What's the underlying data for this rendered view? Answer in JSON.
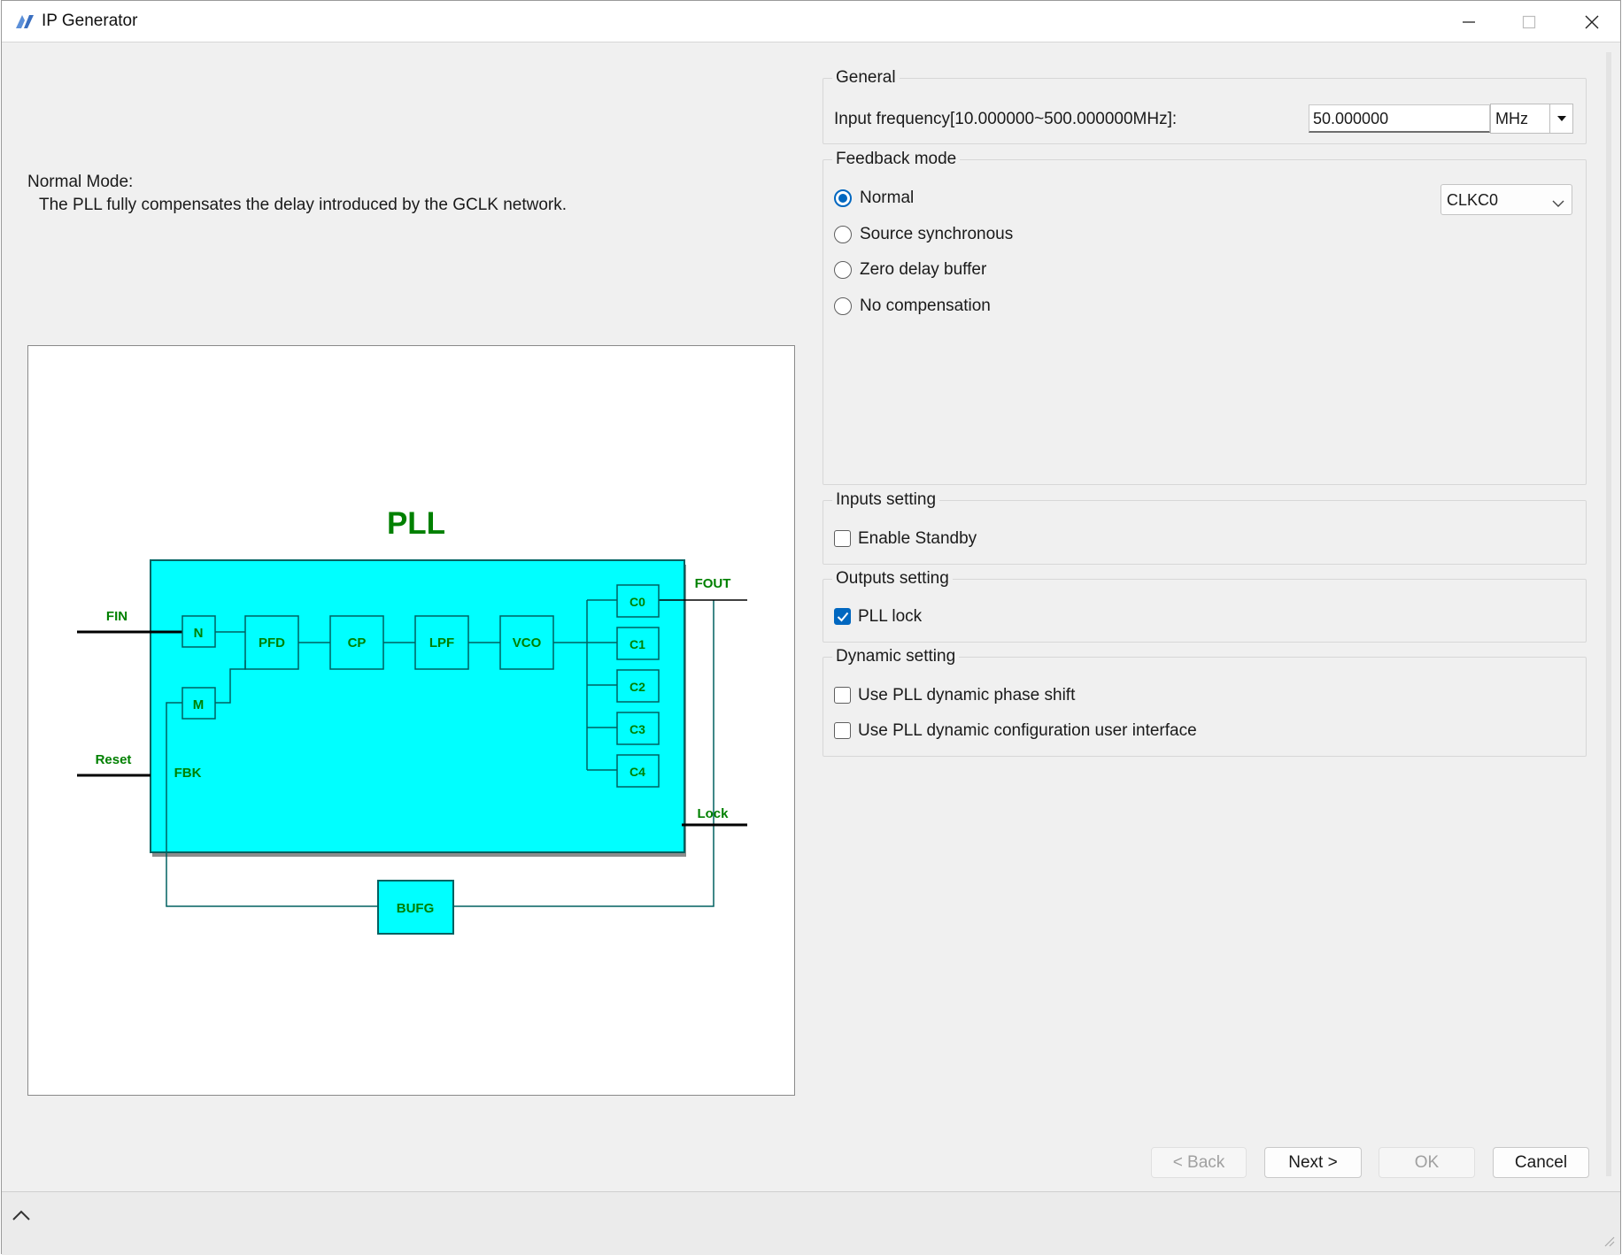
{
  "window": {
    "title": "IP Generator",
    "icons": [
      "app-logo-icon",
      "minimize-icon",
      "maximize-icon",
      "close-icon"
    ]
  },
  "mode": {
    "title": "Normal Mode:",
    "description": "The PLL fully compensates the delay introduced by the GCLK network."
  },
  "diagram": {
    "title": "PLL",
    "inputs": {
      "fin": "FIN",
      "reset": "Reset",
      "fbk": "FBK"
    },
    "outputs": {
      "fout": "FOUT",
      "lock": "Lock"
    },
    "blocks": {
      "n": "N",
      "m": "M",
      "pfd": "PFD",
      "cp": "CP",
      "lpf": "LPF",
      "vco": "VCO",
      "bufg": "BUFG"
    },
    "counters": [
      "C0",
      "C1",
      "C2",
      "C3",
      "C4"
    ],
    "colors": {
      "block_fill": "#00ffff",
      "label": "#008000"
    }
  },
  "general": {
    "legend": "General",
    "input_frequency_label": "Input frequency[10.000000~500.000000MHz]:",
    "input_frequency_value": "50.000000",
    "unit": "MHz"
  },
  "feedback": {
    "legend": "Feedback mode",
    "options": [
      "Normal",
      "Source synchronous",
      "Zero delay buffer",
      "No compensation"
    ],
    "selected": "Normal",
    "clock_select": "CLKC0"
  },
  "inputs_setting": {
    "legend": "Inputs setting",
    "enable_standby": {
      "label": "Enable Standby",
      "checked": false
    }
  },
  "outputs_setting": {
    "legend": "Outputs setting",
    "pll_lock": {
      "label": "PLL lock",
      "checked": true
    }
  },
  "dynamic_setting": {
    "legend": "Dynamic setting",
    "phase_shift": {
      "label": "Use PLL dynamic phase shift",
      "checked": false
    },
    "config_ui": {
      "label": "Use PLL dynamic configuration user interface",
      "checked": false
    }
  },
  "buttons": {
    "back": "< Back",
    "next": "Next >",
    "ok": "OK",
    "cancel": "Cancel"
  },
  "accent_color": "#0067c0"
}
